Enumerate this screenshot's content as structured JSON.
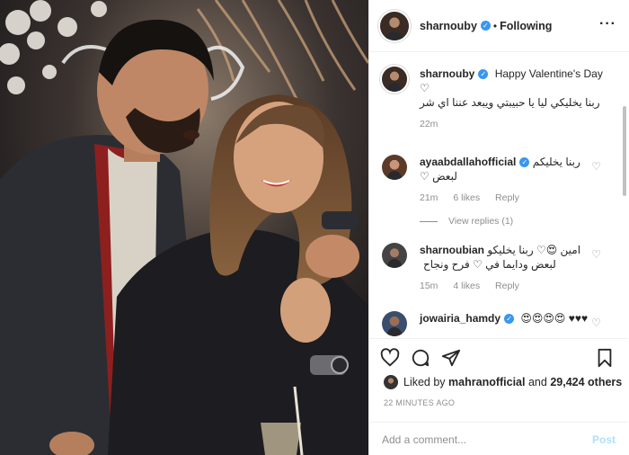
{
  "post": {
    "author": "sharnouby",
    "follow_state": "Following",
    "more_icon": "ellipsis-icon",
    "accent": "#3897f0"
  },
  "caption": {
    "author": "sharnouby",
    "text_en": "Happy Valentine's Day",
    "text_ar": "ربنا يخليكي ليا يا حبيبتي ويبعد عننا اي شر",
    "time": "22m"
  },
  "comments": [
    {
      "author": "ayaabdallahofficial",
      "text": "ربنا يخليكم لبعض ♡",
      "time": "21m",
      "likes": "6 likes",
      "reply": "Reply",
      "view_replies": "View replies (1)"
    },
    {
      "author": "sharnoubian",
      "text": "امين 😍♡ ربنا يخليكو لبعض ودايما في ♡ فرح ونجاح",
      "time": "15m",
      "likes": "4 likes",
      "reply": "Reply"
    },
    {
      "author": "jowairia_hamdy",
      "text": "😍😍😍😍 ♥♥♥"
    }
  ],
  "footer": {
    "liked_prefix": "Liked by",
    "liked_user": "mahranofficial",
    "liked_mid": "and",
    "liked_count": "29,424 others",
    "timestamp": "22 MINUTES AGO",
    "comment_placeholder": "Add a comment...",
    "post_label": "Post"
  }
}
